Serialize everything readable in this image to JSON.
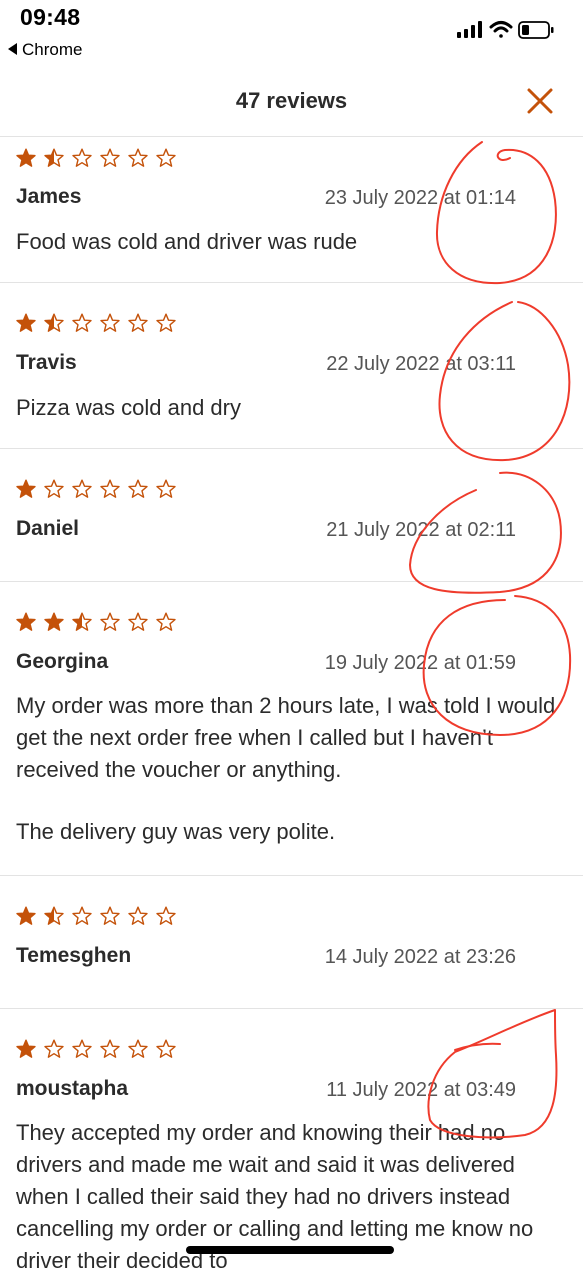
{
  "status_bar": {
    "time": "09:48",
    "back_app": "Chrome"
  },
  "header": {
    "title": "47 reviews"
  },
  "colors": {
    "star": "#c4520a",
    "close": "#c4520a",
    "annotation": "#ef3b2c"
  },
  "reviews": [
    {
      "name": "James",
      "date": "23 July 2022 at 01:14",
      "rating": 1.5,
      "text": [
        "Food was cold and driver was rude"
      ]
    },
    {
      "name": "Travis",
      "date": "22 July 2022 at 03:11",
      "rating": 1.5,
      "text": [
        "Pizza was cold and dry"
      ]
    },
    {
      "name": "Daniel",
      "date": "21 July 2022 at 02:11",
      "rating": 1,
      "text": []
    },
    {
      "name": "Georgina",
      "date": "19 July 2022 at 01:59",
      "rating": 2.5,
      "text": [
        "My order was more than 2 hours late, I was told I would get the next order free when I called but I haven’t received the voucher or anything.",
        "The delivery guy was very polite."
      ]
    },
    {
      "name": "Temesghen",
      "date": "14 July 2022 at 23:26",
      "rating": 1.5,
      "text": []
    },
    {
      "name": "moustapha",
      "date": "11 July 2022 at 03:49",
      "rating": 1,
      "text": [
        "They accepted my order and knowing their had no drivers and made me wait and said it was delivered when I called their said they had no drivers instead cancelling my order or calling and letting me know no driver their decided to"
      ]
    }
  ]
}
